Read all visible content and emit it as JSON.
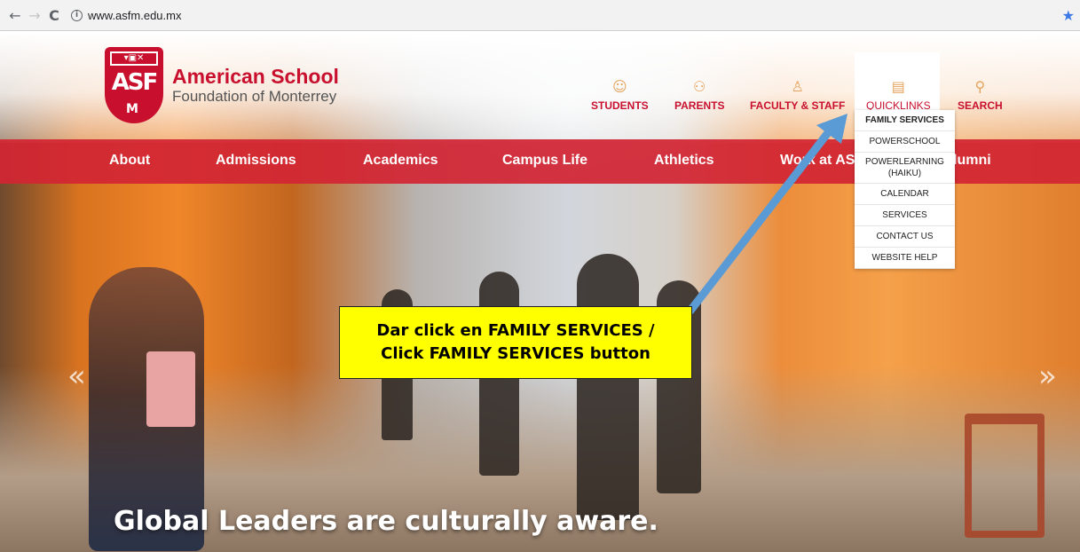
{
  "browser": {
    "back_icon": "←",
    "forward_icon": "→",
    "reload_icon": "C",
    "info_icon": "i",
    "url": "www.asfm.edu.mx",
    "star_icon": "★"
  },
  "logo": {
    "crest_top": "▾▣✕",
    "crest_main": "ASF",
    "crest_bottom": "M",
    "title": "American School",
    "subtitle": "Foundation of Monterrey"
  },
  "topnav": [
    {
      "label": "STUDENTS",
      "icon": "☺"
    },
    {
      "label": "PARENTS",
      "icon": "⚇"
    },
    {
      "label": "FACULTY & STAFF",
      "icon": "♙"
    },
    {
      "label": "QUICKLINKS",
      "icon": "▤"
    },
    {
      "label": "SEARCH",
      "icon": "⚲"
    }
  ],
  "menu": [
    "About",
    "Admissions",
    "Academics",
    "Campus Life",
    "Athletics",
    "Work at AS",
    "lumni"
  ],
  "dropdown": [
    "FAMILY SERVICES",
    "POWERSCHOOL",
    "POWERLEARNING (HAIKU)",
    "CALENDAR",
    "SERVICES",
    "CONTACT US",
    "WEBSITE HELP"
  ],
  "carousel": {
    "prev": "«",
    "next": "»",
    "caption": "Global Leaders are culturally aware."
  },
  "callout": {
    "line1": "Dar click en FAMILY SERVICES /",
    "line2": "Click FAMILY SERVICES button"
  },
  "colors": {
    "brand_red": "#c8102e",
    "callout_yellow": "#ffff00",
    "arrow_blue": "#5b9bd5"
  }
}
